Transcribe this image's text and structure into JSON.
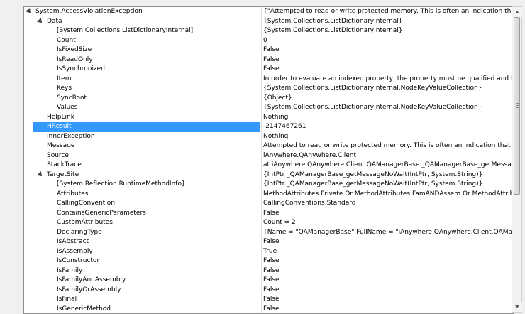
{
  "rows": [
    {
      "name": "System.AccessViolationException",
      "value": "{\"Attempted to read or write protected memory. This is often an indication that other memo",
      "depth": 0,
      "expander": true
    },
    {
      "name": "Data",
      "value": "{System.Collections.ListDictionaryInternal}",
      "depth": 1,
      "expander": true
    },
    {
      "name": "[System.Collections.ListDictionaryInternal]",
      "value": "{System.Collections.ListDictionaryInternal}",
      "depth": 2,
      "expander": false
    },
    {
      "name": "Count",
      "value": "0",
      "depth": 2,
      "expander": false
    },
    {
      "name": "IsFixedSize",
      "value": "False",
      "depth": 2,
      "expander": false
    },
    {
      "name": "IsReadOnly",
      "value": "False",
      "depth": 2,
      "expander": false
    },
    {
      "name": "IsSynchronized",
      "value": "False",
      "depth": 2,
      "expander": false
    },
    {
      "name": "Item",
      "value": "In order to evaluate an indexed property, the property must be qualified and the arguments m",
      "depth": 2,
      "expander": false
    },
    {
      "name": "Keys",
      "value": "{System.Collections.ListDictionaryInternal.NodeKeyValueCollection}",
      "depth": 2,
      "expander": false
    },
    {
      "name": "SyncRoot",
      "value": "{Object}",
      "depth": 2,
      "expander": false
    },
    {
      "name": "Values",
      "value": "{System.Collections.ListDictionaryInternal.NodeKeyValueCollection}",
      "depth": 2,
      "expander": false
    },
    {
      "name": "HelpLink",
      "value": "Nothing",
      "depth": 1,
      "expander": false
    },
    {
      "name": "HResult",
      "value": "-2147467261",
      "depth": 1,
      "expander": false,
      "selected": true
    },
    {
      "name": "InnerException",
      "value": "Nothing",
      "depth": 1,
      "expander": false
    },
    {
      "name": "Message",
      "value": "Attempted to read or write protected memory. This is often an indication that other memory",
      "depth": 1,
      "expander": false
    },
    {
      "name": "Source",
      "value": "iAnywhere.QAnywhere.Client",
      "depth": 1,
      "expander": false
    },
    {
      "name": "StackTrace",
      "value": "   at iAnywhere.QAnywhere.Client.QAManagerBase._QAManagerBase_getMessageNoWait(In",
      "depth": 1,
      "expander": false
    },
    {
      "name": "TargetSite",
      "value": "{IntPtr _QAManagerBase_getMessageNoWait(IntPtr, System.String)}",
      "depth": 1,
      "expander": true
    },
    {
      "name": "[System.Reflection.RuntimeMethodInfo]",
      "value": "{IntPtr _QAManagerBase_getMessageNoWait(IntPtr, System.String)}",
      "depth": 2,
      "expander": false
    },
    {
      "name": "Attributes",
      "value": "MethodAttributes.Private Or MethodAttributes.FamANDAssem Or MethodAttributes.Static C",
      "depth": 2,
      "expander": false
    },
    {
      "name": "CallingConvention",
      "value": "CallingConventions.Standard",
      "depth": 2,
      "expander": false
    },
    {
      "name": "ContainsGenericParameters",
      "value": "False",
      "depth": 2,
      "expander": false
    },
    {
      "name": "CustomAttributes",
      "value": "Count = 2",
      "depth": 2,
      "expander": false
    },
    {
      "name": "DeclaringType",
      "value": "{Name = \"QAManagerBase\" FullName = \"iAnywhere.QAnywhere.Client.QAManagerBase\"}",
      "depth": 2,
      "expander": false
    },
    {
      "name": "IsAbstract",
      "value": "False",
      "depth": 2,
      "expander": false
    },
    {
      "name": "IsAssembly",
      "value": "True",
      "depth": 2,
      "expander": false
    },
    {
      "name": "IsConstructor",
      "value": "False",
      "depth": 2,
      "expander": false
    },
    {
      "name": "IsFamily",
      "value": "False",
      "depth": 2,
      "expander": false
    },
    {
      "name": "IsFamilyAndAssembly",
      "value": "False",
      "depth": 2,
      "expander": false
    },
    {
      "name": "IsFamilyOrAssembly",
      "value": "False",
      "depth": 2,
      "expander": false
    },
    {
      "name": "IsFinal",
      "value": "False",
      "depth": 2,
      "expander": false
    },
    {
      "name": "IsGenericMethod",
      "value": "False",
      "depth": 2,
      "expander": false
    }
  ],
  "colors": {
    "selection": "#3399ff",
    "grid_background": "#ffffff",
    "window_background": "#f0f0f0"
  },
  "icons": {
    "expander": "expanded-triangle-icon",
    "scroll_up": "scroll-up-arrow-icon",
    "scroll_down": "scroll-down-arrow-icon"
  }
}
